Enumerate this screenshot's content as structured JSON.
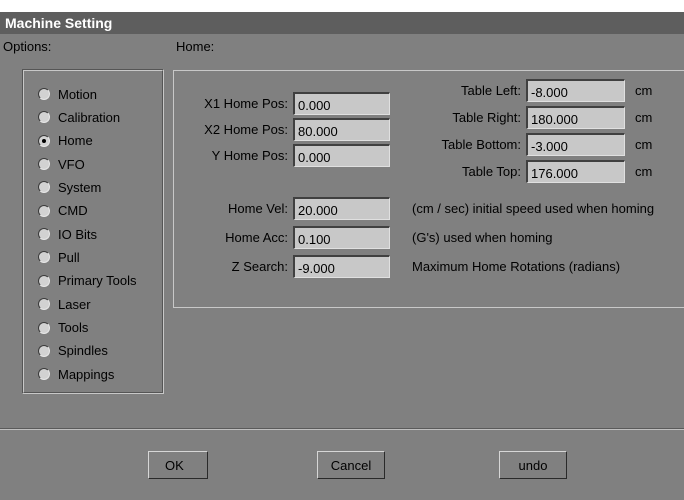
{
  "window": {
    "title": "Machine Setting"
  },
  "options": {
    "heading": "Options:",
    "items": [
      {
        "label": "Motion",
        "checked": false
      },
      {
        "label": "Calibration",
        "checked": false
      },
      {
        "label": "Home",
        "checked": true
      },
      {
        "label": "VFO",
        "checked": false
      },
      {
        "label": "System",
        "checked": false
      },
      {
        "label": "CMD",
        "checked": false
      },
      {
        "label": "IO Bits",
        "checked": false
      },
      {
        "label": "Pull",
        "checked": false
      },
      {
        "label": "Primary Tools",
        "checked": false
      },
      {
        "label": "Laser",
        "checked": false
      },
      {
        "label": "Tools",
        "checked": false
      },
      {
        "label": "Spindles",
        "checked": false
      },
      {
        "label": "Mappings",
        "checked": false
      }
    ]
  },
  "home": {
    "heading": "Home:",
    "x1_home_pos": {
      "label": "X1 Home Pos:",
      "value": "0.000"
    },
    "x2_home_pos": {
      "label": "X2 Home Pos:",
      "value": "80.000"
    },
    "y_home_pos": {
      "label": "Y Home Pos:",
      "value": "0.000"
    },
    "table_left": {
      "label": "Table Left:",
      "value": "-8.000",
      "unit": "cm"
    },
    "table_right": {
      "label": "Table Right:",
      "value": "180.000",
      "unit": "cm"
    },
    "table_bottom": {
      "label": "Table Bottom:",
      "value": "-3.000",
      "unit": "cm"
    },
    "table_top": {
      "label": "Table Top:",
      "value": "176.000",
      "unit": "cm"
    },
    "home_vel": {
      "label": "Home Vel:",
      "value": "20.000",
      "note": "(cm / sec) initial speed used when homing"
    },
    "home_acc": {
      "label": "Home Acc:",
      "value": "0.100",
      "note": "(G's) used when homing"
    },
    "z_search": {
      "label": "Z Search:",
      "value": "-9.000",
      "note": "Maximum Home Rotations (radians)"
    }
  },
  "buttons": {
    "ok": "OK",
    "cancel": "Cancel",
    "undo": "undo"
  }
}
